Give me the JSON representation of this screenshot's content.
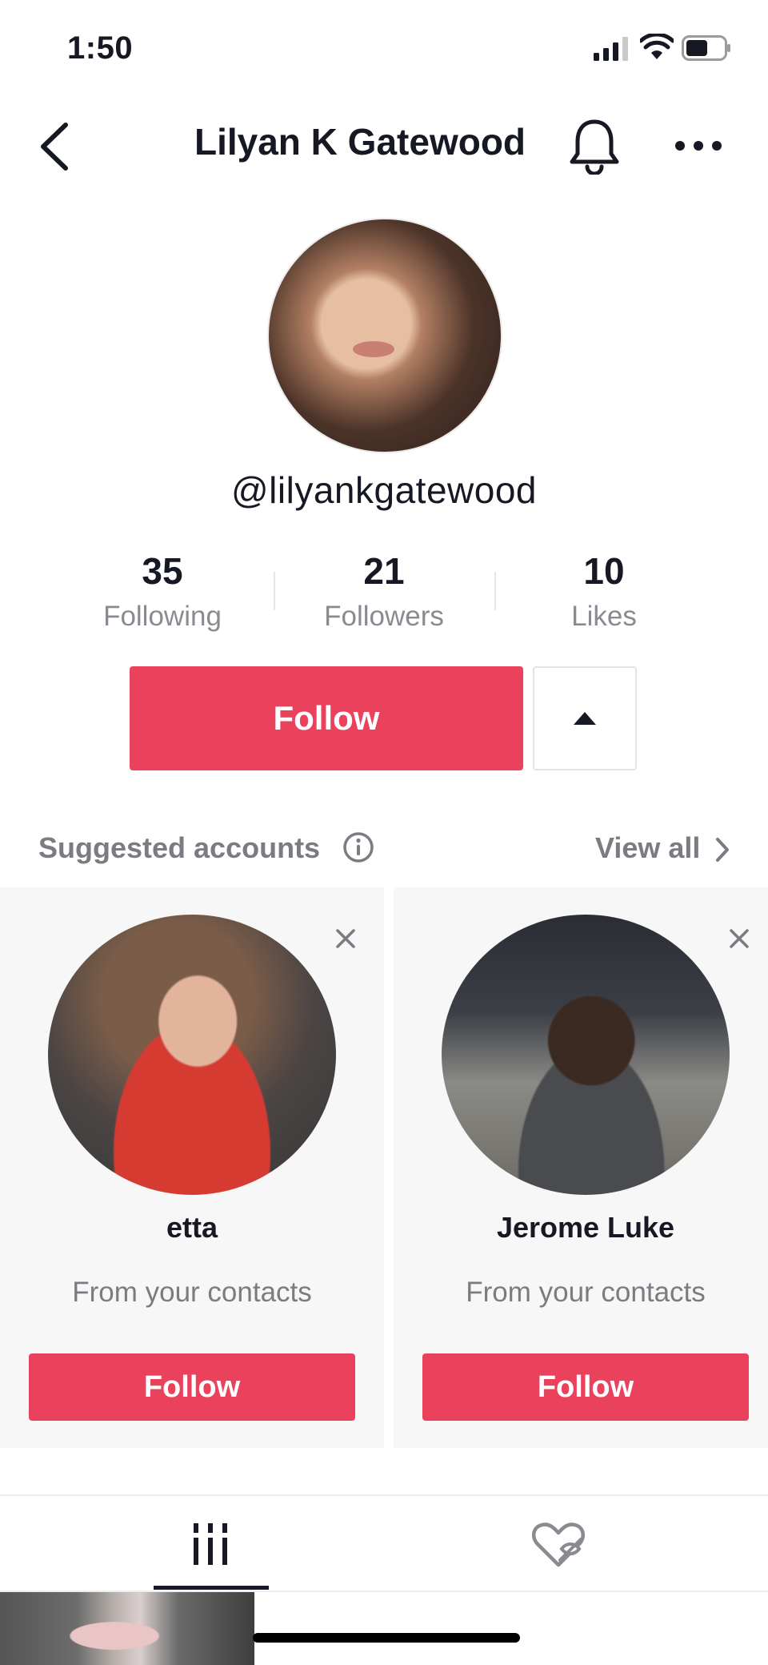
{
  "status_bar": {
    "time": "1:50"
  },
  "header": {
    "title": "Lilyan K Gatewood",
    "back_icon": "chevron-left-icon",
    "bell_icon": "bell-icon",
    "more_icon": "more-horizontal-icon"
  },
  "profile": {
    "username": "@lilyankgatewood",
    "stats": [
      {
        "value": "35",
        "label": "Following"
      },
      {
        "value": "21",
        "label": "Followers"
      },
      {
        "value": "10",
        "label": "Likes"
      }
    ],
    "follow_label": "Follow"
  },
  "suggested": {
    "title": "Suggested accounts",
    "view_all": "View all",
    "cards": [
      {
        "name": "etta",
        "subtitle": "From your contacts",
        "follow_label": "Follow"
      },
      {
        "name": "Jerome Luke",
        "subtitle": "From your contacts",
        "follow_label": "Follow"
      }
    ]
  },
  "tabs": [
    {
      "name": "videos-tab",
      "icon": "grid-icon",
      "active": true
    },
    {
      "name": "liked-tab",
      "icon": "liked-private-icon",
      "active": false
    }
  ],
  "colors": {
    "accent": "#EA425C",
    "text": "#161823",
    "muted": "#8A8B91",
    "card_bg": "#F7F7F7"
  }
}
